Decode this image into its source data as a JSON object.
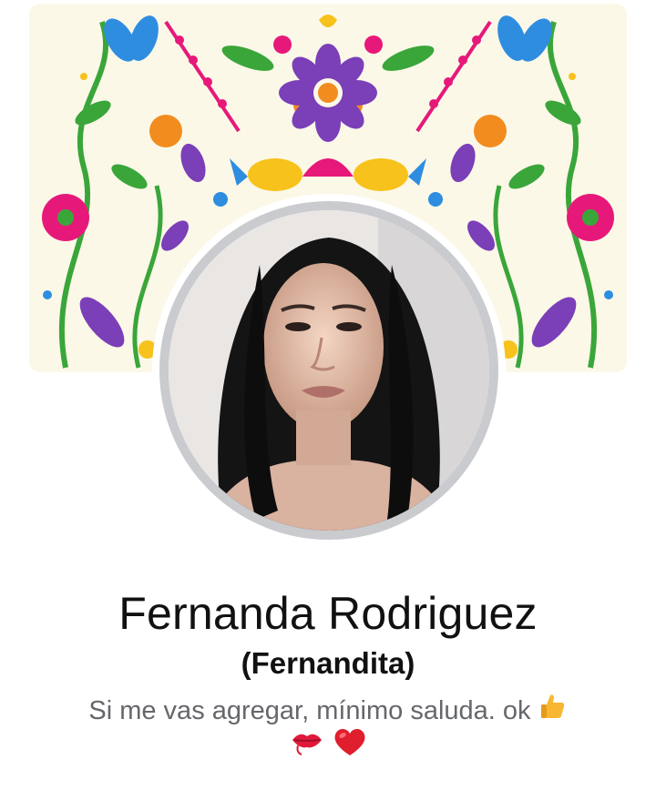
{
  "profile": {
    "name": "Fernanda Rodriguez",
    "nickname": "(Fernandita)",
    "bio_text": "Si me vas agregar, mínimo saluda. ok",
    "bio_emojis_line1": [
      "thumbs-up"
    ],
    "bio_emojis_line2": [
      "kiss-lips",
      "red-heart"
    ]
  },
  "cover_photo": {
    "description_icon": "floral-folk-art-pattern",
    "background_color": "#fbf8e8"
  },
  "colors": {
    "name_text": "#111111",
    "bio_text": "#65676b",
    "avatar_ring": "#c9cbcf"
  }
}
